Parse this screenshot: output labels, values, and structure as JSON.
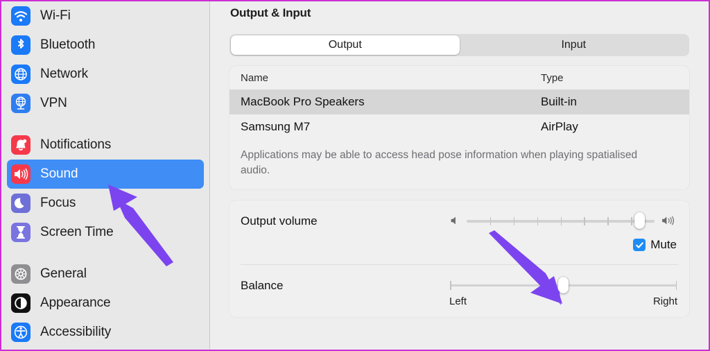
{
  "window": {
    "accent_border": "#cc2fd4",
    "selection_blue": "#3f8df5",
    "annotation_purple": "#7c44ef"
  },
  "sidebar": {
    "groups": [
      {
        "items": [
          {
            "label": "Wi-Fi",
            "icon": "wifi-icon",
            "icon_color": "#1a7af8",
            "selected": false
          },
          {
            "label": "Bluetooth",
            "icon": "bluetooth-icon",
            "icon_color": "#1a7af8",
            "selected": false
          },
          {
            "label": "Network",
            "icon": "network-globe-icon",
            "icon_color": "#1a7af8",
            "selected": false
          },
          {
            "label": "VPN",
            "icon": "vpn-globe-icon",
            "icon_color": "#2f7ef0",
            "selected": false
          }
        ]
      },
      {
        "items": [
          {
            "label": "Notifications",
            "icon": "bell-icon",
            "icon_color": "#f5394a",
            "selected": false
          },
          {
            "label": "Sound",
            "icon": "speaker-icon",
            "icon_color": "#f5394a",
            "selected": true
          },
          {
            "label": "Focus",
            "icon": "moon-icon",
            "icon_color": "#6f6fd8",
            "selected": false
          },
          {
            "label": "Screen Time",
            "icon": "hourglass-icon",
            "icon_color": "#7a74e0",
            "selected": false
          }
        ]
      },
      {
        "items": [
          {
            "label": "General",
            "icon": "gear-icon",
            "icon_color": "#8e8e93",
            "selected": false
          },
          {
            "label": "Appearance",
            "icon": "contrast-icon",
            "icon_color": "#111111",
            "selected": false
          },
          {
            "label": "Accessibility",
            "icon": "accessibility-icon",
            "icon_color": "#1a7af8",
            "selected": false
          }
        ]
      }
    ]
  },
  "main": {
    "title": "Output & Input",
    "segments": [
      {
        "label": "Output",
        "active": true
      },
      {
        "label": "Input",
        "active": false
      }
    ],
    "device_table": {
      "headers": {
        "name": "Name",
        "type": "Type"
      },
      "rows": [
        {
          "name": "MacBook Pro Speakers",
          "type": "Built-in",
          "selected": true
        },
        {
          "name": "Samsung M7",
          "type": "AirPlay",
          "selected": false
        }
      ],
      "note": "Applications may be able to access head pose information when playing spatialised audio."
    },
    "output_volume": {
      "label": "Output volume",
      "value_percent": 92,
      "tick_count": 7,
      "low_icon": "speaker-low-icon",
      "high_icon": "speaker-high-icon",
      "mute": {
        "label": "Mute",
        "checked": true,
        "check_glyph": "✓"
      }
    },
    "balance": {
      "label": "Balance",
      "value_percent": 50,
      "left_caption": "Left",
      "right_caption": "Right"
    }
  },
  "annotations": [
    {
      "name": "arrow-to-sound-item",
      "color": "#7c44ef"
    },
    {
      "name": "arrow-to-balance-thumb",
      "color": "#7c44ef"
    }
  ]
}
